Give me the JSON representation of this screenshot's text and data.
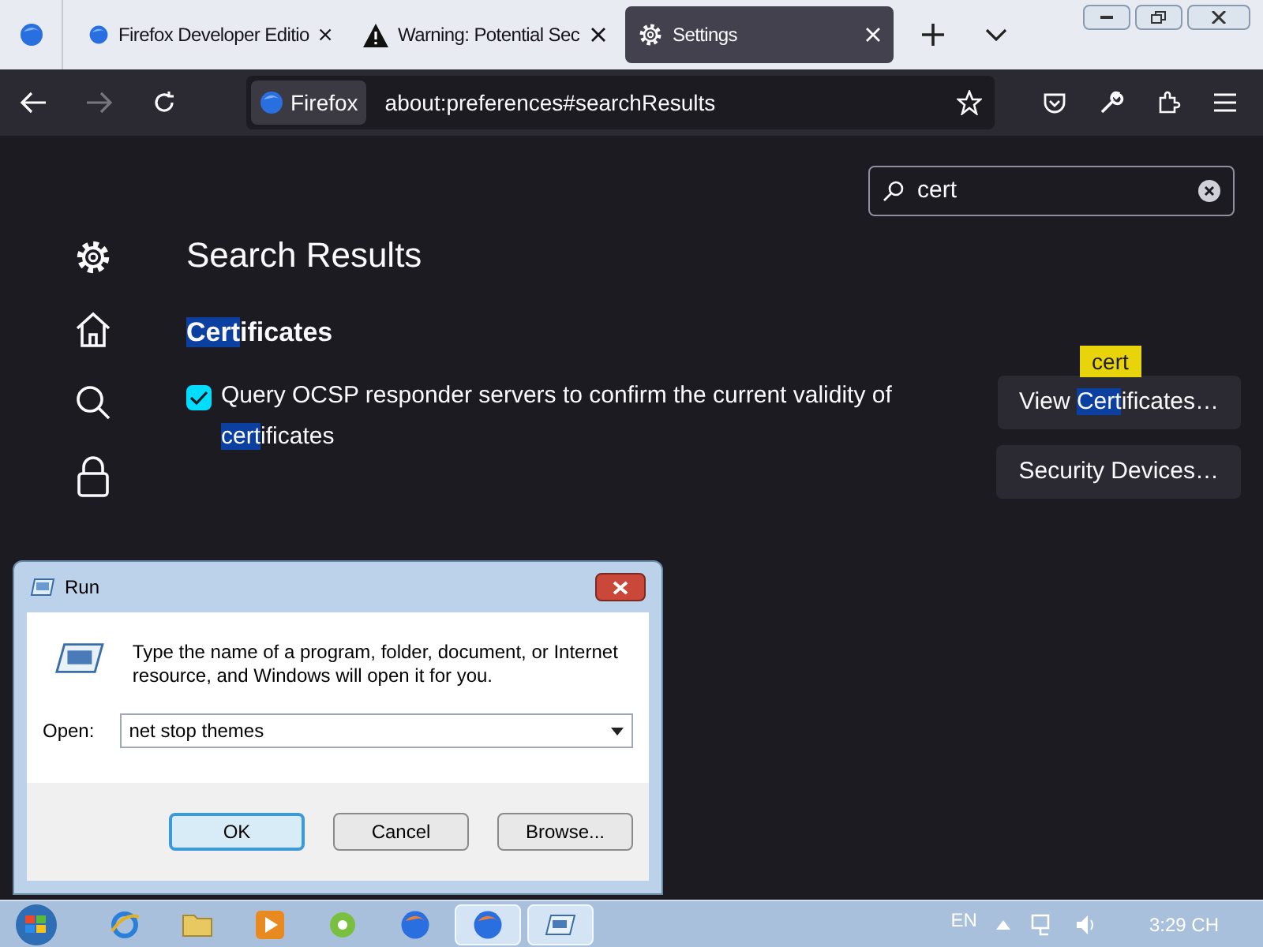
{
  "tabs": [
    {
      "title": "Firefox Developer Editio",
      "kind": "firefox",
      "selected": false
    },
    {
      "title": "Warning: Potential Sec",
      "kind": "warning",
      "selected": false
    },
    {
      "title": "Settings",
      "kind": "gear",
      "selected": true
    }
  ],
  "address_bar": {
    "identity": "Firefox",
    "url": "about:preferences#searchResults"
  },
  "search": {
    "value": "cert"
  },
  "sidebar": [
    {
      "kind": "gear"
    },
    {
      "kind": "home"
    },
    {
      "kind": "search"
    },
    {
      "kind": "lock"
    }
  ],
  "heading": "Search Results",
  "section": {
    "title": [
      {
        "text": "Cert",
        "highlighted": true
      },
      {
        "text": "ificates",
        "highlighted": false
      }
    ],
    "checkbox": {
      "checked": true,
      "label": [
        {
          "text": "Query OCSP responder servers to confirm the current validity of ",
          "highlighted": false
        },
        {
          "text": "cert",
          "highlighted": true
        },
        {
          "text": "ificates",
          "highlighted": false
        }
      ]
    },
    "buttons": [
      {
        "label": [
          {
            "text": "View ",
            "highlighted": false
          },
          {
            "text": "Cert",
            "highlighted": true
          },
          {
            "text": "ificates…",
            "highlighted": false
          }
        ],
        "tooltip": "cert"
      },
      {
        "label": [
          {
            "text": "Security Devices…",
            "highlighted": false
          }
        ]
      }
    ]
  },
  "run_dialog": {
    "title": "Run",
    "description": "Type the name of a program, folder, document, or Internet resource, and Windows will open it for you.",
    "open_label": "Open:",
    "value": "net stop themes",
    "buttons": [
      {
        "label": "OK",
        "default": true
      },
      {
        "label": "Cancel",
        "default": false
      },
      {
        "label": "Browse...",
        "default": false
      }
    ]
  },
  "taskbar": {
    "apps": [
      {
        "kind": "ie",
        "active": false
      },
      {
        "kind": "folder",
        "active": false
      },
      {
        "kind": "media",
        "active": false
      },
      {
        "kind": "green",
        "active": false
      },
      {
        "kind": "firefox",
        "active": false
      },
      {
        "kind": "firefox",
        "active": true
      },
      {
        "kind": "run",
        "active": true
      }
    ],
    "language": "EN",
    "time": "3:29 CH"
  }
}
